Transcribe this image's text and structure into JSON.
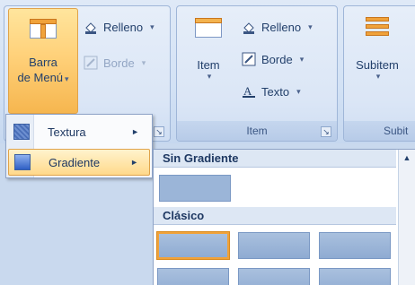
{
  "ribbon": {
    "group1": {
      "big_button_line1": "Barra",
      "big_button_line2": "de Menú",
      "fill_label": "Relleno",
      "border_label": "Borde"
    },
    "group2": {
      "big_button_label": "Item",
      "fill_label": "Relleno",
      "border_label": "Borde",
      "text_label": "Texto",
      "caption": "Item"
    },
    "group3": {
      "big_button_label": "Subitem",
      "caption": "Subit"
    },
    "dropdown_caret": "▾",
    "launcher_glyph": "↘"
  },
  "menu": {
    "items": [
      {
        "label": "Textura",
        "arrow": "►"
      },
      {
        "label": "Gradiente",
        "arrow": "►"
      }
    ]
  },
  "gallery": {
    "sections": [
      {
        "header": "Sin Gradiente"
      },
      {
        "header": "Clásico"
      }
    ],
    "scroll_up": "▲"
  },
  "colors": {
    "accent_orange": "#f0a23a",
    "hover_gold": "#ffd98b",
    "swatch_blue": "#9bb5d8"
  }
}
